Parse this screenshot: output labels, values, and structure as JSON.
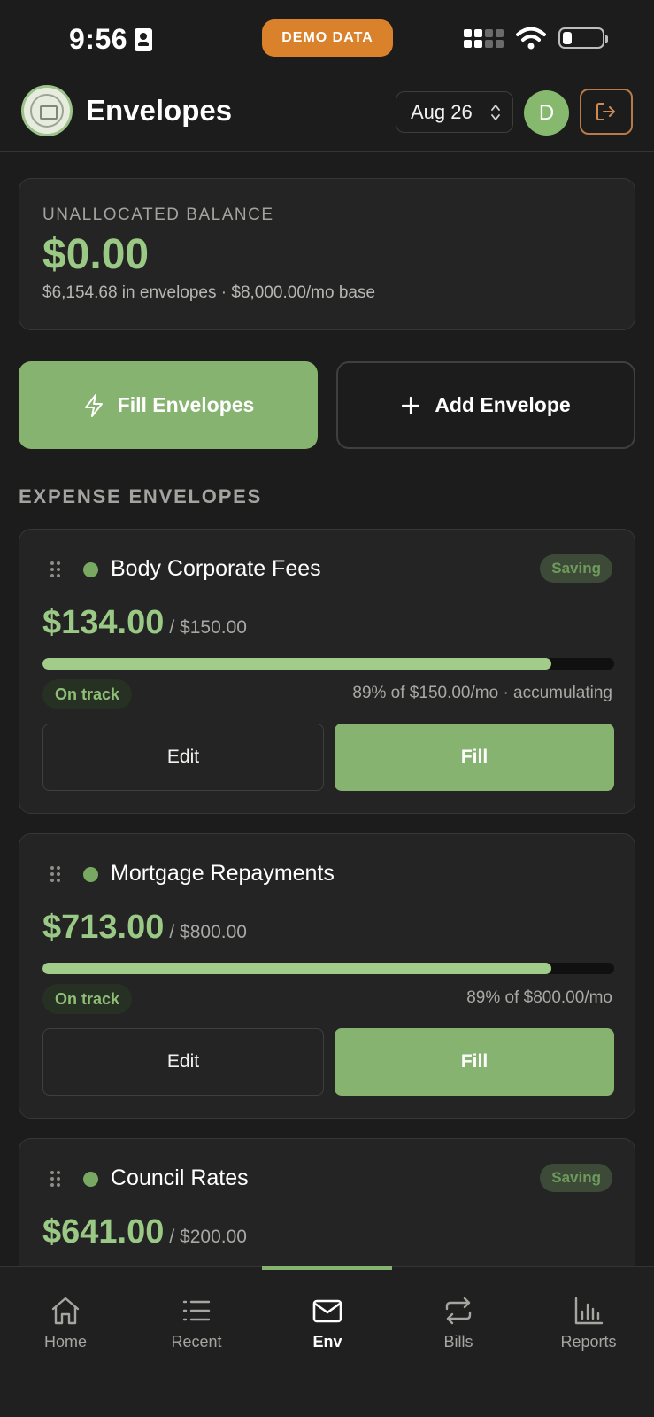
{
  "status_bar": {
    "time": "9:56",
    "demo_label": "DEMO DATA"
  },
  "header": {
    "title": "Envelopes",
    "month": "Aug 26",
    "avatar_initial": "D"
  },
  "balance": {
    "label": "UNALLOCATED BALANCE",
    "value": "$0.00",
    "sub": "$6,154.68 in envelopes · $8,000.00/mo base"
  },
  "actions": {
    "fill_label": "Fill Envelopes",
    "add_label": "Add Envelope"
  },
  "section": {
    "title": "EXPENSE ENVELOPES"
  },
  "envelopes": [
    {
      "name": "Body Corporate Fees",
      "badge": "Saving",
      "amount": "$134.00",
      "target": "/ $150.00",
      "progress": 0.89,
      "status": "On track",
      "note": "89% of $150.00/mo · accumulating",
      "edit_label": "Edit",
      "fill_label": "Fill"
    },
    {
      "name": "Mortgage Repayments",
      "amount": "$713.00",
      "target": "/ $800.00",
      "progress": 0.89,
      "status": "On track",
      "note": "89% of $800.00/mo",
      "edit_label": "Edit",
      "fill_label": "Fill"
    },
    {
      "name": "Council Rates",
      "badge": "Saving",
      "amount": "$641.00",
      "target": "/ $200.00"
    }
  ],
  "nav": [
    {
      "label": "Home",
      "icon": "home-icon"
    },
    {
      "label": "Recent",
      "icon": "list-icon"
    },
    {
      "label": "Env",
      "icon": "envelope-icon",
      "active": true
    },
    {
      "label": "Bills",
      "icon": "repeat-icon"
    },
    {
      "label": "Reports",
      "icon": "bar-chart-icon"
    }
  ],
  "colors": {
    "accent_green": "#86b36f",
    "amount_green": "#9ac985",
    "demo_orange": "#d9822b",
    "background": "#1b1c1b"
  }
}
